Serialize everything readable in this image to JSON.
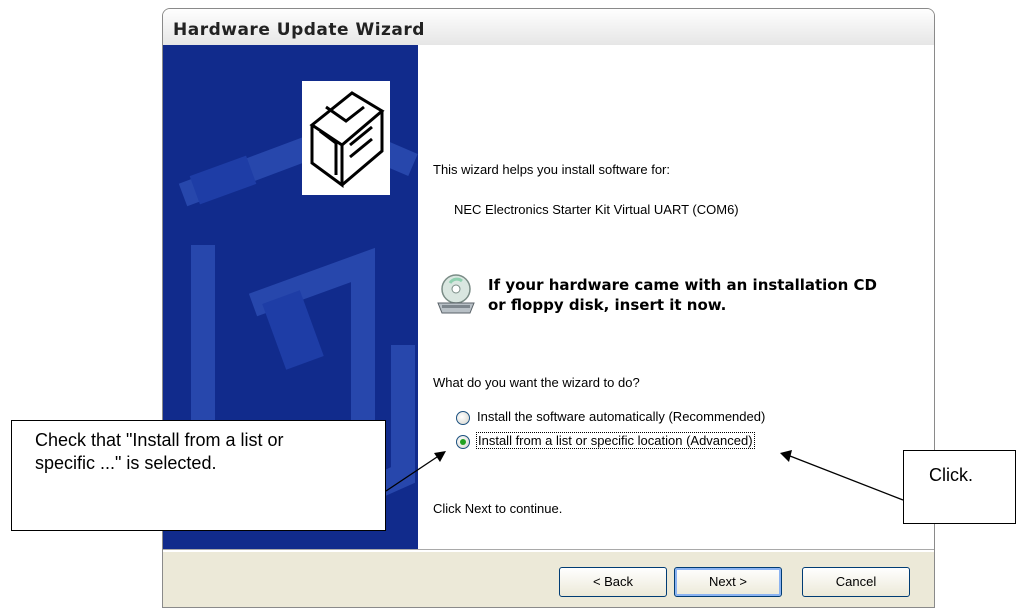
{
  "window": {
    "title": "Hardware Update Wizard"
  },
  "content": {
    "intro": "This wizard helps you install software for:",
    "device": "NEC Electronics Starter Kit Virtual UART (COM6)",
    "cd_prompt_line1": "If your hardware came with an installation CD",
    "cd_prompt_line2": "or floppy disk, insert it now.",
    "question": "What do you want the wizard to do?",
    "options": [
      {
        "label": "Install the software automatically (Recommended)",
        "selected": false
      },
      {
        "label": "Install from a list or specific location (Advanced)",
        "selected": true
      }
    ],
    "continue_text": "Click Next to continue."
  },
  "buttons": {
    "back": "< Back",
    "next": "Next >",
    "cancel": "Cancel"
  },
  "callouts": {
    "left_line1": "Check that \"Install from a list or",
    "left_line2": "specific ...\" is selected.",
    "right": "Click."
  },
  "colors": {
    "side_panel": "#112b8c",
    "radio_selected": "#21a121",
    "dialog_bg": "#ece9d8"
  }
}
